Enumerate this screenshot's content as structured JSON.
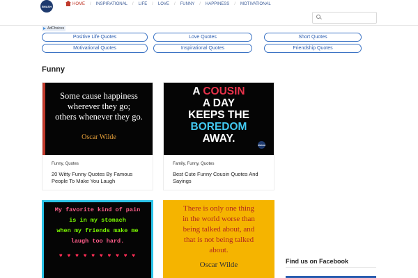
{
  "header": {
    "logo_text": "SMASH",
    "nav": [
      {
        "label": "HOME"
      },
      {
        "label": "INSPIRATIONAL"
      },
      {
        "label": "LIFE"
      },
      {
        "label": "LOVE"
      },
      {
        "label": "FUNNY"
      },
      {
        "label": "HAPPINESS"
      },
      {
        "label": "MOTIVATIONAL"
      }
    ],
    "search_placeholder": ""
  },
  "ad": {
    "label": "AdChoices"
  },
  "quick_links": [
    "Positive Life Quotes",
    "Love Quotes",
    "Short Quotes",
    "Motivational Quotes",
    "Inspirational Quotes",
    "Friendship Quotes"
  ],
  "section_title": "Funny",
  "cards": [
    {
      "categories": "Funny, Quotes",
      "title": "20 Witty Funny Quotes By Famous People To Make You Laugh",
      "image_lines": [
        "Some cause happiness",
        "wherever they go;",
        "others whenever they go."
      ],
      "image_author": "Oscar Wilde"
    },
    {
      "categories": "Family, Funny, Quotes",
      "title": "Best Cute Funny Cousin Quotes And Sayings",
      "image_lines": [
        "A",
        "COUSIN",
        "A DAY",
        "KEEPS THE",
        "BOREDOM",
        "AWAY."
      ],
      "image_badge": "SMASH"
    },
    {
      "image_lines": [
        "My favorite kind of pain",
        "is in my stomach",
        "when my friends make me",
        "laugh too hard."
      ],
      "image_hearts": "♥ ♥ ♥ ♥ ♥ ♥ ♥ ♥ ♥ ♥"
    },
    {
      "image_lines": [
        "There is only one thing",
        "in the world worse than",
        "being talked about, and",
        "that is not being talked",
        "about."
      ],
      "image_author": "Oscar Wilde"
    }
  ],
  "sidebar": {
    "facebook_title": "Find us on Facebook"
  },
  "colors": {
    "accent": "#2a5db0",
    "home": "#c0392b"
  }
}
